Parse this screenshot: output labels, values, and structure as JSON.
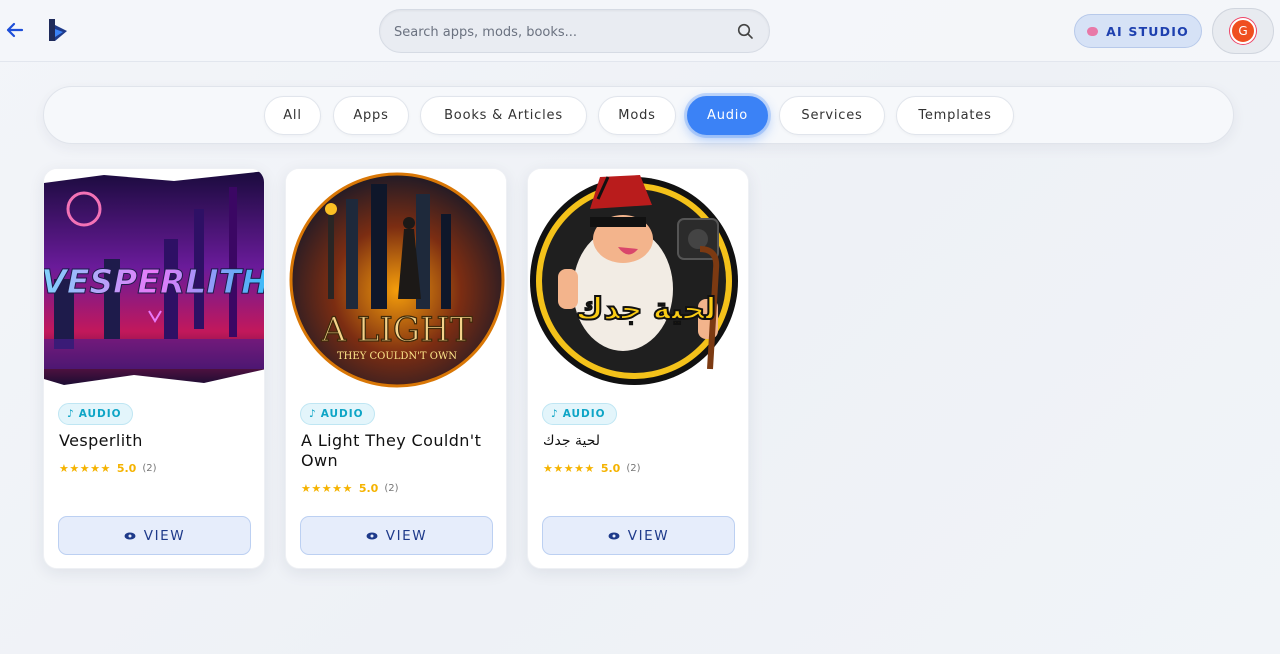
{
  "header": {
    "search_placeholder": "Search apps, mods, books...",
    "ai_studio_label": "AI STUDIO",
    "avatar_initial": "G"
  },
  "filters": [
    {
      "label": "All",
      "active": false
    },
    {
      "label": "Apps",
      "active": false
    },
    {
      "label": "Books & Articles",
      "active": false
    },
    {
      "label": "Mods",
      "active": false
    },
    {
      "label": "Audio",
      "active": true
    },
    {
      "label": "Services",
      "active": false
    },
    {
      "label": "Templates",
      "active": false
    }
  ],
  "cards": [
    {
      "badge": "AUDIO",
      "title": "Vesperlith",
      "stars": "★★★★★",
      "score": "5.0",
      "count": "(2)",
      "view_label": "VIEW",
      "art_text": "VESPERLITH"
    },
    {
      "badge": "AUDIO",
      "title": "A Light They Couldn't Own",
      "stars": "★★★★★",
      "score": "5.0",
      "count": "(2)",
      "view_label": "VIEW",
      "art_text": "A LIGHT",
      "art_subtext": "THEY COULDN'T OWN"
    },
    {
      "badge": "AUDIO",
      "title": "لحية جدك",
      "stars": "★★★★★",
      "score": "5.0",
      "count": "(2)",
      "view_label": "VIEW",
      "art_text": "لحية جدك"
    }
  ],
  "colors": {
    "accent": "#3b82f6",
    "badge_text": "#0ea5c6",
    "star": "#f5b301",
    "avatar": "#ef4f1f"
  }
}
